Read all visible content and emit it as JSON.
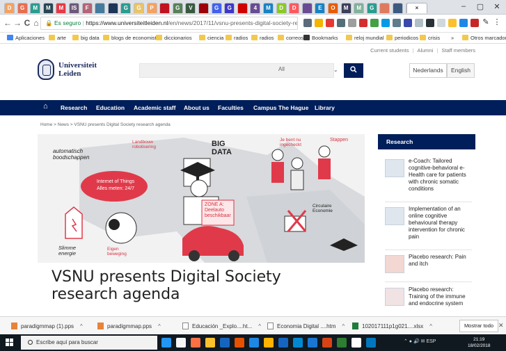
{
  "browser": {
    "tab_letters": [
      "D",
      "G",
      "M",
      "M",
      "M",
      "IS",
      "F",
      "",
      "",
      "G",
      "G",
      "P",
      "",
      "G",
      "V",
      "",
      "G",
      "G",
      "",
      "4",
      "M",
      "D",
      "D",
      "",
      "E",
      "O",
      "M",
      "M",
      "G",
      "",
      "",
      "G"
    ],
    "active_tab_close": "×",
    "window": {
      "minimize": "–",
      "maximize": "▢",
      "close": "✕"
    },
    "back": "←",
    "forward": "→",
    "reload": "C",
    "home": "⌂",
    "secure_label": "Es seguro",
    "url_base": "https://www.universiteitleiden.nl",
    "url_path": "/en/news/2017/11/vsnu-presents-digital-society-research-...",
    "bookmarks": [
      "Aplicaciones",
      "arte",
      "big data",
      "blogs de economista",
      "diccionarios",
      "ciencia",
      "radios",
      "radios",
      "correos",
      "Bookmarks",
      "reloj mundial",
      "periodicos",
      "crisis",
      "Otros marcadores"
    ],
    "bookmarks_more": "»"
  },
  "site": {
    "toplinks": [
      "Current students",
      "Alumni",
      "Staff members"
    ],
    "logo": {
      "line1": "Universiteit",
      "line2": "Leiden"
    },
    "search": {
      "scope": "All",
      "chevron": "⌄",
      "button_icon": "🔍"
    },
    "languages": [
      "Nederlands",
      "English"
    ],
    "nav": {
      "home_icon": "⌂",
      "items": [
        "Research",
        "Education",
        "Academic staff",
        "About us",
        "Faculties",
        "Campus The Hague",
        "Library"
      ]
    },
    "breadcrumb": "Home  >  News  >  VSNU presents Digital Society research agenda",
    "hero_text": {
      "a1": "automatisch",
      "a2": "boodschappen",
      "b1": "Landbouw",
      "b2": "robotisering",
      "c1": "BIG",
      "c2": "DATA",
      "d1": "Internet of Things",
      "d2": "Alles meten: 24/7",
      "e1": "ZONE A:",
      "e2": "Deelauto",
      "e3": "beschikbaar",
      "f1": "Je bent nu",
      "f2": "ingecheckt",
      "g1": "Stappen",
      "h1": "Circulaire",
      "h2": "Economie",
      "i1": "Slimme",
      "i2": "energie",
      "j1": "Eigen",
      "j2": "beweging"
    },
    "headline_line1": "VSNU presents Digital Society",
    "headline_line2": "research agenda",
    "sidebar": {
      "title": "Research",
      "items": [
        "e-Coach: Tailored cognitive-behavioral e-Health care for patients with chronic somatic conditions",
        "Implementation of an online cognitive behavioural therapy intervention for chronic pain",
        "Placebo research: Pain and itch",
        "Placebo research: Training of the immune and endocrine system"
      ]
    }
  },
  "downloads": {
    "files": [
      "paradigmmap (1).pps",
      "paradigmmap.pps",
      "Educación _Explo....ht...",
      "Economia Digital ....htm",
      "102017111p1g021....xlsx"
    ],
    "chevron": "^",
    "show_all": "Mostrar todo",
    "close": "✕"
  },
  "taskbar": {
    "search_placeholder": "Escribe aquí para buscar",
    "tray_text": "ESP",
    "time": "21:19",
    "date": "18/02/2018"
  },
  "colors": {
    "uni_blue": "#001e5a",
    "tab_bg": "#dfe3e8"
  }
}
